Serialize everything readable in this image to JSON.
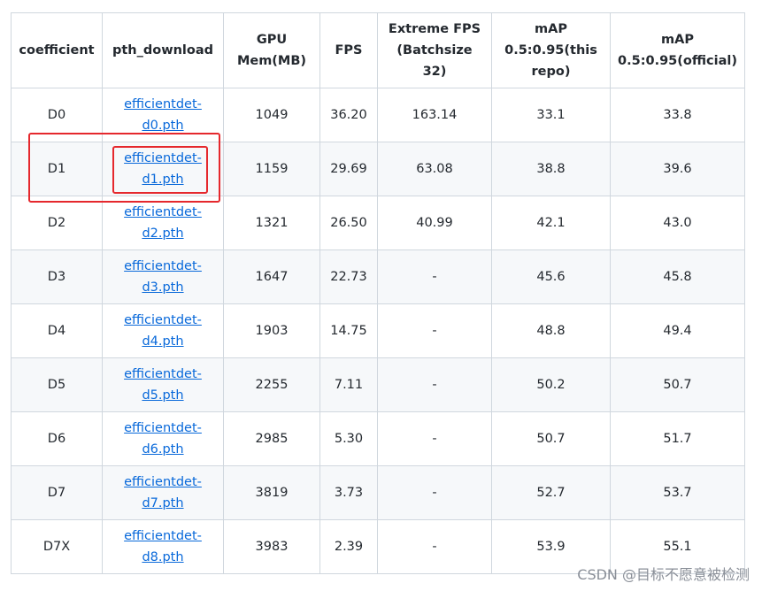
{
  "table": {
    "headers": [
      "coefficient",
      "pth_download",
      "GPU Mem(MB)",
      "FPS",
      "Extreme FPS (Batchsize 32)",
      "mAP 0.5:0.95(this repo)",
      "mAP 0.5:0.95(official)"
    ],
    "rows": [
      {
        "coef": "D0",
        "link": "efficientdet-d0.pth",
        "mem": "1049",
        "fps": "36.20",
        "xfps": "163.14",
        "map_repo": "33.1",
        "map_official": "33.8"
      },
      {
        "coef": "D1",
        "link": "efficientdet-d1.pth",
        "mem": "1159",
        "fps": "29.69",
        "xfps": "63.08",
        "map_repo": "38.8",
        "map_official": "39.6"
      },
      {
        "coef": "D2",
        "link": "efficientdet-d2.pth",
        "mem": "1321",
        "fps": "26.50",
        "xfps": "40.99",
        "map_repo": "42.1",
        "map_official": "43.0"
      },
      {
        "coef": "D3",
        "link": "efficientdet-d3.pth",
        "mem": "1647",
        "fps": "22.73",
        "xfps": "-",
        "map_repo": "45.6",
        "map_official": "45.8"
      },
      {
        "coef": "D4",
        "link": "efficientdet-d4.pth",
        "mem": "1903",
        "fps": "14.75",
        "xfps": "-",
        "map_repo": "48.8",
        "map_official": "49.4"
      },
      {
        "coef": "D5",
        "link": "efficientdet-d5.pth",
        "mem": "2255",
        "fps": "7.11",
        "xfps": "-",
        "map_repo": "50.2",
        "map_official": "50.7"
      },
      {
        "coef": "D6",
        "link": "efficientdet-d6.pth",
        "mem": "2985",
        "fps": "5.30",
        "xfps": "-",
        "map_repo": "50.7",
        "map_official": "51.7"
      },
      {
        "coef": "D7",
        "link": "efficientdet-d7.pth",
        "mem": "3819",
        "fps": "3.73",
        "xfps": "-",
        "map_repo": "52.7",
        "map_official": "53.7"
      },
      {
        "coef": "D7X",
        "link": "efficientdet-d8.pth",
        "mem": "3983",
        "fps": "2.39",
        "xfps": "-",
        "map_repo": "53.9",
        "map_official": "55.1"
      }
    ]
  },
  "watermark": "CSDN @目标不愿意被检测",
  "colors": {
    "link": "#0969da",
    "highlight": "#e5282d",
    "border": "#d0d7de",
    "stripe": "#f6f8fa"
  }
}
